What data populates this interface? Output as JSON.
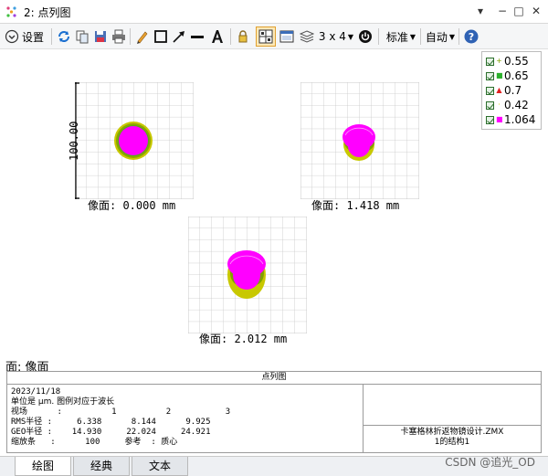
{
  "window": {
    "title": "2: 点列图",
    "controls": [
      "▾",
      "−",
      "□",
      "✕"
    ]
  },
  "toolbar": {
    "settings_label": "设置",
    "layout_label": "3 x 4",
    "standard_label": "标准",
    "auto_label": "自动"
  },
  "spots": {
    "scale_label": "100.00",
    "panels": [
      {
        "caption": "像面: 0.000 mm"
      },
      {
        "caption": "像面: 1.418 mm"
      },
      {
        "caption": "像面: 2.012 mm"
      }
    ]
  },
  "legend": {
    "items": [
      {
        "label": "0.55",
        "color": "#7fa000",
        "marker": "+"
      },
      {
        "label": "0.65",
        "color": "#2bb02b",
        "marker": "■"
      },
      {
        "label": "0.7",
        "color": "#e02020",
        "marker": "▲"
      },
      {
        "label": "0.42",
        "color": "#c8c800",
        "marker": "·"
      },
      {
        "label": "1.064",
        "color": "#ff00ff",
        "marker": "■"
      }
    ]
  },
  "surface_label": "面: 像面",
  "info": {
    "header": "点列图",
    "date": "2023/11/18",
    "units_note": "单位是 μm. 图例对应于波长",
    "field_row": "视场      :          1          2           3",
    "rms_row": "RMS半径 :     6.338      8.144      9.925",
    "geo_row": "GEO半径 :    14.930     22.024     24.921",
    "scale_row": "缩放条   :      100     参考  : 质心",
    "file_name": "卡塞格林折返物镜设计.ZMX",
    "config": "1的结构1"
  },
  "tabs": [
    "绘图",
    "经典",
    "文本"
  ],
  "watermark": "CSDN @追光_OD"
}
